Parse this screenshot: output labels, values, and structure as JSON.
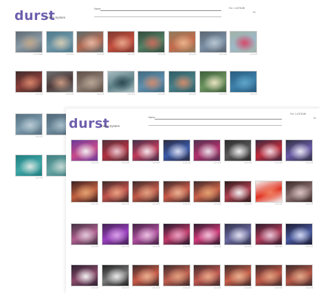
{
  "back_window": {
    "logo": "durst",
    "tagline": "Index System",
    "search_label": "Name:",
    "meta_line1": "Fot. 1-0378-88",
    "meta_line2": "01",
    "rows": [
      [
        {
          "caption": "1 2 0 9-000",
          "colors": [
            "#8a9aa6",
            "#c0a78a",
            "#5f6b74"
          ]
        },
        {
          "caption": "0 0 1 5 5",
          "colors": [
            "#6f97a8",
            "#d3c9b2",
            "#4d7a8c"
          ]
        },
        {
          "caption": "0 0 1 5 5",
          "colors": [
            "#b36a52",
            "#e4b5a2",
            "#5d6a6a"
          ]
        },
        {
          "caption": "0 0 1 5 5",
          "colors": [
            "#c54e3e",
            "#e3a58a",
            "#7d3a30"
          ]
        },
        {
          "caption": "0 0 1 5 5",
          "colors": [
            "#548065",
            "#c66a5a",
            "#324c3d"
          ]
        },
        {
          "caption": "0 0 1 5 5",
          "colors": [
            "#c56b4c",
            "#e8b48c",
            "#8e7a5a"
          ]
        },
        {
          "caption": "0 0 1 5 5",
          "colors": [
            "#7a8fa4",
            "#b7c4cf",
            "#5b6572"
          ]
        },
        {
          "caption": "0 0 1 5 5",
          "colors": [
            "#9db8c8",
            "#d64a6a",
            "#a1b2a6"
          ]
        }
      ],
      [
        {
          "caption": "0 0 1 5 5",
          "colors": [
            "#8a3e3a",
            "#d2846a",
            "#3e2b2a"
          ]
        },
        {
          "caption": "0 0 1 5 5",
          "colors": [
            "#4e3b3b",
            "#c79a82",
            "#6f6f6f"
          ]
        },
        {
          "caption": "0 0 1 5 5",
          "colors": [
            "#8b7a70",
            "#b5a292",
            "#5e5048"
          ]
        },
        {
          "caption": "0 0 1 5 5",
          "colors": [
            "#5d8187",
            "#2f4b55",
            "#a7bcc0"
          ]
        },
        {
          "caption": "0 0 1 5 5",
          "colors": [
            "#5e8fae",
            "#cf8a6e",
            "#40697f"
          ]
        },
        {
          "caption": "0 0 1 5 5",
          "colors": [
            "#4a7f88",
            "#cf8a6a",
            "#2e5d65"
          ]
        },
        {
          "caption": "0 0 1 5 5",
          "colors": [
            "#6d9560",
            "#e8e0c0",
            "#3e5e3a"
          ]
        },
        {
          "caption": "0 0 1 5 5",
          "colors": [
            "#3d7fa8",
            "#5ea4c8",
            "#2a5c80"
          ]
        }
      ],
      [
        {
          "caption": "0 0 1 5 5",
          "colors": [
            "#7b9aac",
            "#b9cad4",
            "#55707f"
          ]
        },
        {
          "caption": "0 0 1 5 5",
          "colors": [
            "#6f8c9e",
            "#a8bdc8",
            "#4f6877"
          ]
        }
      ],
      [
        {
          "caption": "0 0 1 5 5",
          "colors": [
            "#3fa6a6",
            "#d9e6e2",
            "#1f7d80"
          ]
        },
        {
          "caption": "0 0 1 5 5",
          "colors": [
            "#67a5a4",
            "#c3d6d2",
            "#3e7f80"
          ]
        }
      ]
    ]
  },
  "front_window": {
    "logo": "durst",
    "tagline": "Index System",
    "search_label": "Name:",
    "meta_line1": "Fot. 1-0378-88",
    "meta_line2": "01",
    "rows": [
      [
        {
          "caption": "0 0 1 5 5",
          "colors": [
            "#c84a8a",
            "#f0eef2",
            "#6a3a9a"
          ]
        },
        {
          "caption": "0 0 1 5 5",
          "colors": [
            "#b03040",
            "#e8c8d0",
            "#50303a"
          ]
        },
        {
          "caption": "0 0 1 5 5",
          "colors": [
            "#c03a5a",
            "#f2e6ea",
            "#40304a"
          ]
        },
        {
          "caption": "0 0 1 5 5",
          "colors": [
            "#3a5aa8",
            "#d8dcf0",
            "#2a2a40"
          ]
        },
        {
          "caption": "0 0 1 5 5",
          "colors": [
            "#b0306a",
            "#e8e0ea",
            "#503050"
          ]
        },
        {
          "caption": "0 0 1 5 5",
          "colors": [
            "#5a5a5a",
            "#eeeeee",
            "#2a2a2a"
          ]
        },
        {
          "caption": "0 0 1 5 5",
          "colors": [
            "#c02a3a",
            "#f0d8e0",
            "#3a2a40"
          ]
        },
        {
          "caption": "0 0 1 5 5",
          "colors": [
            "#6a5aa8",
            "#e8e6f2",
            "#303040"
          ]
        }
      ],
      [
        {
          "caption": "0 0 1 5 5",
          "colors": [
            "#c06040",
            "#e0a070",
            "#3a2020"
          ]
        },
        {
          "caption": "0 0 1 5 5",
          "colors": [
            "#c0504a",
            "#e8a080",
            "#3a2a2a"
          ]
        },
        {
          "caption": "0 0 1 5 5",
          "colors": [
            "#c05848",
            "#e0a080",
            "#3a2a2a"
          ]
        },
        {
          "caption": "0 0 1 5 5",
          "colors": [
            "#c85a48",
            "#e8b090",
            "#3a2a2a"
          ]
        },
        {
          "caption": "0 0 1 5 5",
          "colors": [
            "#c86048",
            "#e0a070",
            "#3a2a2a"
          ]
        },
        {
          "caption": "0 0 1 5 5",
          "colors": [
            "#b04050",
            "#f0f0f0",
            "#2a1a1a"
          ]
        },
        {
          "caption": "0 0 1 5 5",
          "colors": [
            "#e03020",
            "#f08060",
            "#f4f0ee"
          ]
        },
        {
          "caption": "0 0 1 5 5",
          "colors": [
            "#8a7070",
            "#d8c0c0",
            "#3a2a2a"
          ]
        }
      ],
      [
        {
          "caption": "0 0 1 5 5",
          "colors": [
            "#b06090",
            "#e0c8d8",
            "#403040"
          ]
        },
        {
          "caption": "0 0 1 5 5",
          "colors": [
            "#9a40c0",
            "#d8a0e8",
            "#402050"
          ]
        },
        {
          "caption": "0 0 1 5 5",
          "colors": [
            "#b050a0",
            "#e8c0e0",
            "#402040"
          ]
        },
        {
          "caption": "0 0 1 5 5",
          "colors": [
            "#c03a6a",
            "#e8a0c0",
            "#20182a"
          ]
        },
        {
          "caption": "0 0 1 5 5",
          "colors": [
            "#d03a7a",
            "#f0c0d8",
            "#2a1a2a"
          ]
        },
        {
          "caption": "0 0 1 5 5",
          "colors": [
            "#6a6aa0",
            "#e0e0f0",
            "#30304a"
          ]
        },
        {
          "caption": "0 0 1 5 5",
          "colors": [
            "#b03a5a",
            "#e8c8d8",
            "#2a1a2a"
          ]
        },
        {
          "caption": "0 0 1 5 5",
          "colors": [
            "#4a5aa0",
            "#d0d8f0",
            "#1a1a30"
          ]
        }
      ],
      [
        {
          "caption": "0 0 1 5 5",
          "colors": [
            "#8a4a6a",
            "#f2f2f2",
            "#2a2030"
          ]
        },
        {
          "caption": "0 0 1 5 5",
          "colors": [
            "#7a7a7a",
            "#e8e8e8",
            "#202020"
          ]
        },
        {
          "caption": "0 0 1 5 5",
          "colors": [
            "#c85a48",
            "#e8b090",
            "#3a2a2a"
          ]
        },
        {
          "caption": "0 0 1 5 5",
          "colors": [
            "#c06050",
            "#e0a080",
            "#3a2a2a"
          ]
        },
        {
          "caption": "0 0 1 5 5",
          "colors": [
            "#c05850",
            "#e8a888",
            "#3a2a2a"
          ]
        },
        {
          "caption": "0 0 1 5 5",
          "colors": [
            "#c8604a",
            "#e8b090",
            "#3a2a2a"
          ]
        },
        {
          "caption": "0 0 1 5 5",
          "colors": [
            "#c05848",
            "#e0a080",
            "#3a2a2a"
          ]
        },
        {
          "caption": "0 0 1 5 5",
          "colors": [
            "#b85848",
            "#e0a888",
            "#3a2a2a"
          ]
        }
      ]
    ]
  }
}
